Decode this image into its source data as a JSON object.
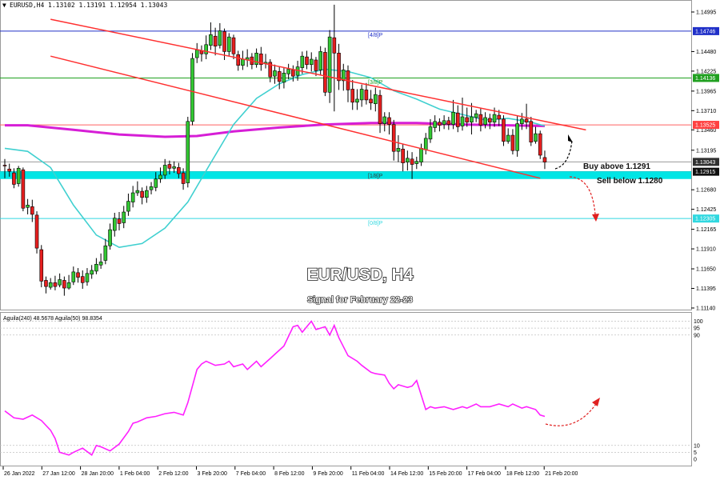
{
  "header": {
    "symbol_label": "EURUSD,H4",
    "ohlc": "1.13102 1.13191 1.12954 1.13043"
  },
  "overlay": {
    "title": "EUR/USD, H4",
    "subtitle": "Signal for February 22-23",
    "buy_text": "Buy above 1.1291",
    "sell_text": "Sell below 1.1280"
  },
  "price_axis": {
    "ticks": [
      "1.14995",
      "1.14480",
      "1.14225",
      "1.13965",
      "1.13710",
      "1.13460",
      "1.13195",
      "1.12680",
      "1.12425",
      "1.12165",
      "1.11910",
      "1.11650",
      "1.11395",
      "1.11140"
    ],
    "boxed_labels": [
      {
        "name": "pivot-4-8",
        "text": "1.14746",
        "color": "#2030c8"
      },
      {
        "name": "pivot-3-8",
        "text": "1.14136",
        "color": "#20a020"
      },
      {
        "name": "red-level",
        "text": "1.13525",
        "color": "#ff4040"
      },
      {
        "name": "current",
        "text": "1.13043",
        "color": "#303030"
      },
      {
        "name": "pivot-1-8",
        "text": "1.12915",
        "color": "#101010"
      },
      {
        "name": "pivot-0-8",
        "text": "1.12305",
        "color": "#30d8e0"
      }
    ]
  },
  "pivot_labels": [
    {
      "name": "pivot-4-8-label",
      "text": "[4/8]P",
      "color": "#2030c8"
    },
    {
      "name": "pivot-3-8-label",
      "text": "[3/8]P",
      "color": "#20a020"
    },
    {
      "name": "pivot-1-8-label",
      "text": "[1/8]P",
      "color": "#333333"
    },
    {
      "name": "pivot-0-8-label",
      "text": "[0/8]P",
      "color": "#30d8e0"
    }
  ],
  "time_axis": {
    "labels": [
      "26 Jan 2022",
      "27 Jan 12:00",
      "28 Jan 20:00",
      "1 Feb 04:00",
      "2 Feb 12:00",
      "3 Feb 20:00",
      "7 Feb 04:00",
      "8 Feb 12:00",
      "9 Feb 20:00",
      "11 Feb 04:00",
      "14 Feb 12:00",
      "15 Feb 20:00",
      "17 Feb 04:00",
      "18 Feb 12:00",
      "21 Feb 20:00"
    ]
  },
  "indicator": {
    "label": "Aguila(240) 48.5678  Aguila(50) 98.8354",
    "ticks": [
      "100",
      "95",
      "90",
      "10",
      "5",
      "0"
    ]
  },
  "colors": {
    "bull": "#32c832",
    "bear": "#e61e1e",
    "channel": "#ff3030",
    "sma_slow": "#d61ed6",
    "sma_fast": "#40d0d0",
    "zone": "#00e5e5",
    "indicator_line": "#ff20ff"
  },
  "chart_data": {
    "type": "candlestick",
    "symbol": "EURUSD",
    "timeframe": "H4",
    "ylim": [
      1.1114,
      1.15
    ],
    "horizontal_levels": [
      {
        "label": "[4/8]P",
        "value": 1.14746
      },
      {
        "label": "[3/8]P",
        "value": 1.14136
      },
      {
        "label": "",
        "value": 1.13525
      },
      {
        "label": "",
        "value": 1.13043
      },
      {
        "label": "[1/8]P",
        "value": 1.12915
      },
      {
        "label": "[0/8]P",
        "value": 1.12305
      }
    ],
    "support_zone": [
      1.1282,
      1.1292
    ],
    "channel": {
      "upper": [
        [
          8,
          1.149
        ],
        [
          127,
          1.1346
        ]
      ],
      "lower": [
        [
          8,
          1.1442
        ],
        [
          117,
          1.1283
        ]
      ]
    },
    "signals": {
      "buy_above": 1.1291,
      "sell_below": 1.128
    },
    "candles": [
      [
        1.13,
        1.1299,
        1.1308,
        1.1283
      ],
      [
        1.1295,
        1.1292,
        1.1302,
        1.1285
      ],
      [
        1.129,
        1.1275,
        1.1296,
        1.127
      ],
      [
        1.1276,
        1.1296,
        1.1299,
        1.1272
      ],
      [
        1.1294,
        1.1244,
        1.1297,
        1.124
      ],
      [
        1.1245,
        1.1248,
        1.1256,
        1.1236
      ],
      [
        1.1246,
        1.1236,
        1.1255,
        1.1226
      ],
      [
        1.1235,
        1.1192,
        1.124,
        1.1185
      ],
      [
        1.119,
        1.1149,
        1.1196,
        1.1141
      ],
      [
        1.115,
        1.1142,
        1.1155,
        1.1133
      ],
      [
        1.1141,
        1.1147,
        1.1153,
        1.1138
      ],
      [
        1.1147,
        1.1142,
        1.1156,
        1.1137
      ],
      [
        1.1144,
        1.1151,
        1.1159,
        1.1141
      ],
      [
        1.115,
        1.114,
        1.1155,
        1.113
      ],
      [
        1.114,
        1.1147,
        1.1157,
        1.1138
      ],
      [
        1.1148,
        1.1161,
        1.1168,
        1.1144
      ],
      [
        1.116,
        1.1154,
        1.1166,
        1.1147
      ],
      [
        1.1155,
        1.1147,
        1.1163,
        1.1139
      ],
      [
        1.1148,
        1.1159,
        1.1166,
        1.1143
      ],
      [
        1.1158,
        1.1163,
        1.117,
        1.1152
      ],
      [
        1.1162,
        1.1171,
        1.1179,
        1.1158
      ],
      [
        1.117,
        1.1174,
        1.1185,
        1.1165
      ],
      [
        1.1176,
        1.1195,
        1.1204,
        1.1171
      ],
      [
        1.1195,
        1.1216,
        1.1224,
        1.119
      ],
      [
        1.1215,
        1.1231,
        1.1238,
        1.1207
      ],
      [
        1.123,
        1.1224,
        1.1239,
        1.1215
      ],
      [
        1.1225,
        1.1239,
        1.1247,
        1.1218
      ],
      [
        1.124,
        1.1253,
        1.1263,
        1.1234
      ],
      [
        1.1252,
        1.1264,
        1.1273,
        1.1245
      ],
      [
        1.1264,
        1.1267,
        1.1279,
        1.126
      ],
      [
        1.1266,
        1.1258,
        1.1271,
        1.1249
      ],
      [
        1.1258,
        1.1267,
        1.1273,
        1.1251
      ],
      [
        1.1268,
        1.1272,
        1.1278,
        1.1262
      ],
      [
        1.1271,
        1.1282,
        1.1291,
        1.1266
      ],
      [
        1.1282,
        1.1287,
        1.1297,
        1.1277
      ],
      [
        1.1287,
        1.13,
        1.1308,
        1.1282
      ],
      [
        1.1301,
        1.1296,
        1.1306,
        1.1288
      ],
      [
        1.1296,
        1.1298,
        1.1305,
        1.129
      ],
      [
        1.1297,
        1.1289,
        1.1303,
        1.1283
      ],
      [
        1.129,
        1.1276,
        1.1296,
        1.1268
      ],
      [
        1.1277,
        1.1357,
        1.1363,
        1.1271
      ],
      [
        1.1357,
        1.1439,
        1.1446,
        1.1352
      ],
      [
        1.144,
        1.145,
        1.1459,
        1.1433
      ],
      [
        1.1449,
        1.1445,
        1.1456,
        1.1435
      ],
      [
        1.1445,
        1.1457,
        1.1469,
        1.1438
      ],
      [
        1.1456,
        1.147,
        1.1486,
        1.145
      ],
      [
        1.1468,
        1.1455,
        1.1479,
        1.1443
      ],
      [
        1.1456,
        1.1475,
        1.1485,
        1.1452
      ],
      [
        1.1474,
        1.1448,
        1.1478,
        1.1437
      ],
      [
        1.1448,
        1.1467,
        1.1472,
        1.1442
      ],
      [
        1.1466,
        1.1445,
        1.147,
        1.1438
      ],
      [
        1.1444,
        1.143,
        1.1449,
        1.1423
      ],
      [
        1.143,
        1.1438,
        1.1449,
        1.1424
      ],
      [
        1.1437,
        1.144,
        1.1451,
        1.1428
      ],
      [
        1.1441,
        1.1431,
        1.1446,
        1.1425
      ],
      [
        1.1431,
        1.1446,
        1.1452,
        1.1427
      ],
      [
        1.1445,
        1.1431,
        1.1454,
        1.1423
      ],
      [
        1.1432,
        1.1434,
        1.1445,
        1.1426
      ],
      [
        1.1434,
        1.1415,
        1.1438,
        1.1408
      ],
      [
        1.1416,
        1.1423,
        1.1431,
        1.1406
      ],
      [
        1.1422,
        1.1409,
        1.1428,
        1.1399
      ],
      [
        1.1408,
        1.142,
        1.1427,
        1.14
      ],
      [
        1.1419,
        1.1425,
        1.1432,
        1.1412
      ],
      [
        1.1424,
        1.1416,
        1.143,
        1.1409
      ],
      [
        1.1417,
        1.1428,
        1.1436,
        1.141
      ],
      [
        1.1427,
        1.1442,
        1.1448,
        1.1419
      ],
      [
        1.1441,
        1.1431,
        1.1449,
        1.1425
      ],
      [
        1.1431,
        1.1438,
        1.1447,
        1.1422
      ],
      [
        1.1437,
        1.1423,
        1.1441,
        1.1416
      ],
      [
        1.1424,
        1.1448,
        1.1455,
        1.1418
      ],
      [
        1.1447,
        1.1395,
        1.1453,
        1.139
      ],
      [
        1.1395,
        1.1467,
        1.1476,
        1.1381
      ],
      [
        1.1466,
        1.1446,
        1.1509,
        1.137
      ],
      [
        1.1446,
        1.141,
        1.1458,
        1.1398
      ],
      [
        1.141,
        1.1424,
        1.1432,
        1.1397
      ],
      [
        1.1423,
        1.1398,
        1.143,
        1.1382
      ],
      [
        1.1399,
        1.1382,
        1.1411,
        1.1372
      ],
      [
        1.1382,
        1.1386,
        1.1399,
        1.1372
      ],
      [
        1.1385,
        1.1399,
        1.1405,
        1.1376
      ],
      [
        1.1398,
        1.1385,
        1.1407,
        1.1379
      ],
      [
        1.1386,
        1.1381,
        1.1398,
        1.1372
      ],
      [
        1.138,
        1.1392,
        1.1401,
        1.137
      ],
      [
        1.1391,
        1.1354,
        1.1398,
        1.1342
      ],
      [
        1.1354,
        1.1363,
        1.1369,
        1.1344
      ],
      [
        1.1362,
        1.1353,
        1.1369,
        1.134
      ],
      [
        1.1353,
        1.1318,
        1.1359,
        1.1306
      ],
      [
        1.1318,
        1.1322,
        1.1339,
        1.1304
      ],
      [
        1.1321,
        1.1303,
        1.1328,
        1.1292
      ],
      [
        1.1304,
        1.1309,
        1.1319,
        1.1293
      ],
      [
        1.1308,
        1.1301,
        1.1317,
        1.1282
      ],
      [
        1.1302,
        1.1305,
        1.1311,
        1.1295
      ],
      [
        1.1304,
        1.1322,
        1.1328,
        1.1299
      ],
      [
        1.132,
        1.1335,
        1.1342,
        1.1314
      ],
      [
        1.1334,
        1.135,
        1.136,
        1.1329
      ],
      [
        1.1349,
        1.1357,
        1.1365,
        1.1343
      ],
      [
        1.1356,
        1.1352,
        1.1361,
        1.1344
      ],
      [
        1.1353,
        1.1358,
        1.1365,
        1.1347
      ],
      [
        1.1358,
        1.1353,
        1.1363,
        1.1346
      ],
      [
        1.1353,
        1.1369,
        1.1385,
        1.1347
      ],
      [
        1.1368,
        1.135,
        1.1378,
        1.1343
      ],
      [
        1.1351,
        1.1363,
        1.1388,
        1.1345
      ],
      [
        1.1362,
        1.1356,
        1.1375,
        1.135
      ],
      [
        1.1356,
        1.1363,
        1.1381,
        1.134
      ],
      [
        1.1362,
        1.1367,
        1.1372,
        1.1356
      ],
      [
        1.1366,
        1.1352,
        1.1374,
        1.1344
      ],
      [
        1.1353,
        1.1362,
        1.1369,
        1.1348
      ],
      [
        1.1361,
        1.1356,
        1.1367,
        1.1347
      ],
      [
        1.1356,
        1.1366,
        1.1375,
        1.135
      ],
      [
        1.1365,
        1.136,
        1.1372,
        1.1351
      ],
      [
        1.136,
        1.1331,
        1.1365,
        1.1325
      ],
      [
        1.1331,
        1.1339,
        1.1348,
        1.1328
      ],
      [
        1.1339,
        1.1319,
        1.1347,
        1.1314
      ],
      [
        1.1319,
        1.1354,
        1.1364,
        1.1311
      ],
      [
        1.1354,
        1.136,
        1.1368,
        1.1346
      ],
      [
        1.136,
        1.1356,
        1.138,
        1.1347
      ],
      [
        1.1357,
        1.133,
        1.1363,
        1.1325
      ],
      [
        1.1331,
        1.1341,
        1.135,
        1.1328
      ],
      [
        1.1341,
        1.1313,
        1.1345,
        1.1308
      ],
      [
        1.131,
        1.1304,
        1.1319,
        1.1295
      ]
    ],
    "sma_slow_240": [
      [
        0,
        1.1352
      ],
      [
        5,
        1.1352
      ],
      [
        15,
        1.1346
      ],
      [
        25,
        1.134
      ],
      [
        35,
        1.1337
      ],
      [
        42,
        1.1338
      ],
      [
        50,
        1.1344
      ],
      [
        60,
        1.1349
      ],
      [
        70,
        1.1353
      ],
      [
        80,
        1.1355
      ],
      [
        90,
        1.1355
      ],
      [
        100,
        1.1353
      ],
      [
        110,
        1.1352
      ],
      [
        118,
        1.1351
      ]
    ],
    "sma_fast_50": [
      [
        0,
        1.1322
      ],
      [
        5,
        1.1318
      ],
      [
        10,
        1.1297
      ],
      [
        15,
        1.1248
      ],
      [
        20,
        1.1209
      ],
      [
        25,
        1.1193
      ],
      [
        30,
        1.1198
      ],
      [
        35,
        1.1218
      ],
      [
        40,
        1.1252
      ],
      [
        45,
        1.1303
      ],
      [
        50,
        1.1353
      ],
      [
        55,
        1.1387
      ],
      [
        60,
        1.1406
      ],
      [
        65,
        1.1418
      ],
      [
        70,
        1.1425
      ],
      [
        75,
        1.1422
      ],
      [
        80,
        1.1414
      ],
      [
        85,
        1.1397
      ],
      [
        90,
        1.1386
      ],
      [
        95,
        1.1373
      ],
      [
        100,
        1.1366
      ],
      [
        105,
        1.1359
      ],
      [
        110,
        1.1361
      ],
      [
        115,
        1.1356
      ],
      [
        118,
        1.1351
      ]
    ],
    "indicator": {
      "name": "Aguila",
      "ylim": [
        0,
        100
      ],
      "levels": [
        100,
        95,
        90,
        10,
        5,
        0
      ],
      "values": [
        [
          0,
          35
        ],
        [
          2,
          30
        ],
        [
          4,
          29
        ],
        [
          6,
          32
        ],
        [
          8,
          28
        ],
        [
          10,
          21
        ],
        [
          11,
          15
        ],
        [
          12,
          5
        ],
        [
          14,
          3
        ],
        [
          15,
          5
        ],
        [
          17,
          8
        ],
        [
          19,
          3
        ],
        [
          20,
          10
        ],
        [
          21,
          9
        ],
        [
          23,
          6
        ],
        [
          25,
          11
        ],
        [
          27,
          20
        ],
        [
          28,
          26
        ],
        [
          29,
          27
        ],
        [
          31,
          30
        ],
        [
          33,
          31
        ],
        [
          35,
          33
        ],
        [
          37,
          34
        ],
        [
          39,
          32
        ],
        [
          40,
          41
        ],
        [
          42,
          65
        ],
        [
          43,
          69
        ],
        [
          44,
          71
        ],
        [
          46,
          68
        ],
        [
          48,
          69
        ],
        [
          49,
          71
        ],
        [
          50,
          67
        ],
        [
          52,
          69
        ],
        [
          53,
          65
        ],
        [
          55,
          71
        ],
        [
          56,
          67
        ],
        [
          58,
          73
        ],
        [
          59,
          76
        ],
        [
          61,
          82
        ],
        [
          63,
          96
        ],
        [
          64,
          97
        ],
        [
          65,
          92
        ],
        [
          67,
          100
        ],
        [
          68,
          94
        ],
        [
          70,
          96
        ],
        [
          71,
          90
        ],
        [
          72,
          97
        ],
        [
          73,
          88
        ],
        [
          75,
          75
        ],
        [
          77,
          71
        ],
        [
          78,
          68
        ],
        [
          80,
          63
        ],
        [
          81,
          62
        ],
        [
          83,
          61
        ],
        [
          84,
          55
        ],
        [
          85,
          51
        ],
        [
          86,
          54
        ],
        [
          88,
          52
        ],
        [
          89,
          53
        ],
        [
          90,
          57
        ],
        [
          92,
          36
        ],
        [
          93,
          38
        ],
        [
          94,
          37
        ],
        [
          96,
          38
        ],
        [
          98,
          36
        ],
        [
          100,
          38
        ],
        [
          101,
          37
        ],
        [
          103,
          40
        ],
        [
          104,
          38
        ],
        [
          106,
          38
        ],
        [
          108,
          40
        ],
        [
          110,
          38
        ],
        [
          111,
          40
        ],
        [
          113,
          37
        ],
        [
          114,
          38
        ],
        [
          116,
          36
        ],
        [
          117,
          32
        ],
        [
          118,
          31
        ]
      ]
    }
  }
}
